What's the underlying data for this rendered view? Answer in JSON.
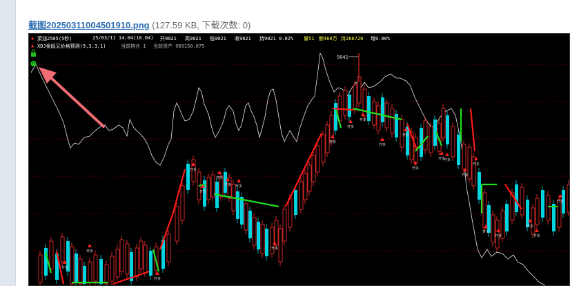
{
  "attachment": {
    "filename": "截图20250311004501910.png",
    "meta": "(127.59 KB, 下载次数: 0)"
  },
  "chart": {
    "header": {
      "symbol": "菜油2505(5秒)",
      "datetime": "25/03/11 14:04(10.04)",
      "open": "开9021",
      "high": "高9021",
      "low": "低9021",
      "close": "收9021",
      "change": "持9021 0.02%",
      "volume": "量51",
      "turnover": "额460万",
      "openint": "持266720",
      "increase": "增0.00%"
    },
    "indicator_line": {
      "name": "XDJ金既又价格预测(9,3,3,1)",
      "position": "当前持仓 1",
      "equity": "当前资产 969150.075"
    },
    "high_marker": "9041",
    "signal_label": "开多",
    "colors": {
      "bull": "#ff3030",
      "bear": "#00d4e0",
      "green_line": "#20e020",
      "red_line": "#ff1a1a",
      "white_line": "#e8e8e8",
      "arrow": "#f06c74"
    }
  }
}
